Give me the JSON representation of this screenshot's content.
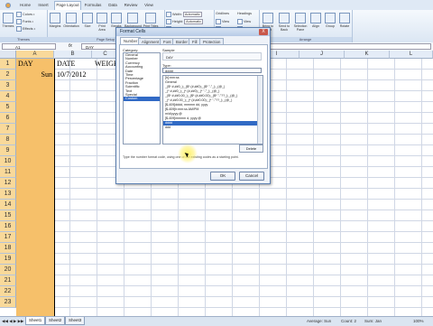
{
  "ribbon_tabs": [
    "Home",
    "Insert",
    "Page Layout",
    "Formulas",
    "Data",
    "Review",
    "View"
  ],
  "active_tab": "Page Layout",
  "ribbon": {
    "themes_label": "Themes",
    "colors": "Colors •",
    "fonts": "Fonts •",
    "effects": "Effects •",
    "margins": "Margins",
    "orientation": "Orientation",
    "size": "Size",
    "print_area": "Print Area",
    "breaks": "Breaks",
    "background": "Background",
    "print_titles": "Print Titles",
    "page_setup_label": "Page Setup",
    "width_label": "Width:",
    "width_value": "Automatic",
    "height_label": "Height:",
    "height_value": "Automatic",
    "scale_label": "Scale:",
    "gridlines": "Gridlines",
    "headings": "Headings",
    "view": "View",
    "print": "Print",
    "bring_front": "Bring to Front",
    "send_back": "Send to Back",
    "selection_pane": "Selection Pane",
    "align": "Align",
    "group": "Group",
    "rotate": "Rotate",
    "arrange_label": "Arrange"
  },
  "formula_bar": {
    "name_box": "A1",
    "fx": "fx",
    "content": "DAY"
  },
  "columns": [
    "A",
    "B",
    "C",
    "D",
    "E",
    "F",
    "G",
    "H",
    "I",
    "J",
    "K",
    "L"
  ],
  "rows": [
    "1",
    "2",
    "3",
    "4",
    "5",
    "6",
    "7",
    "8",
    "9",
    "10",
    "11",
    "12",
    "13",
    "14",
    "15",
    "16",
    "17",
    "18",
    "19",
    "20",
    "21",
    "22",
    "23"
  ],
  "cells": {
    "A1": "DAY",
    "B1": "DATE",
    "C1": "WEIGH",
    "A2": "Sun",
    "B2": "10/7/2012"
  },
  "dialog": {
    "title": "Format Cells",
    "close": "X",
    "tabs": [
      "Number",
      "Alignment",
      "Font",
      "Border",
      "Fill",
      "Protection"
    ],
    "active_tab": "Number",
    "category_label": "Category:",
    "categories": [
      "General",
      "Number",
      "Currency",
      "Accounting",
      "Date",
      "Time",
      "Percentage",
      "Fraction",
      "Scientific",
      "Text",
      "Special",
      "Custom"
    ],
    "selected_category": "Custom",
    "sample_label": "Sample",
    "sample_value": "DAY",
    "type_label": "Type:",
    "type_value": "dddd",
    "types": [
      "[h]:mm:ss",
      "General",
      "_($* #,##0_);_($* (#,##0);_($* \"-\"_);_(@_)",
      "_(* #,##0_);_(* (#,##0);_(* \"-\"_);_(@_)",
      "_($* #,##0.00_);_($* (#,##0.00);_($* \"-\"??_);_(@_)",
      "_(* #,##0.00_);_(* (#,##0.00);_(* \"-\"??_);_(@_)",
      "[$-409]dddd, mmmm dd, yyyy",
      "[$-409]h:mm:ss AM/PM",
      "m/d/yyyy;@",
      "[$-409]mmmm d, yyyy;@",
      "dddd",
      "ddd"
    ],
    "selected_type": "dddd",
    "delete_label": "Delete",
    "hint": "Type the number format code, using one of the existing codes as a starting point.",
    "ok": "OK",
    "cancel": "Cancel"
  },
  "sheet_tabs": [
    "Sheet1",
    "Sheet2",
    "Sheet3"
  ],
  "active_sheet": "Sheet1",
  "status": {
    "average": "Average: Sun",
    "count": "Count: 2",
    "sum": "Sum: Jan",
    "zoom": "100%"
  }
}
